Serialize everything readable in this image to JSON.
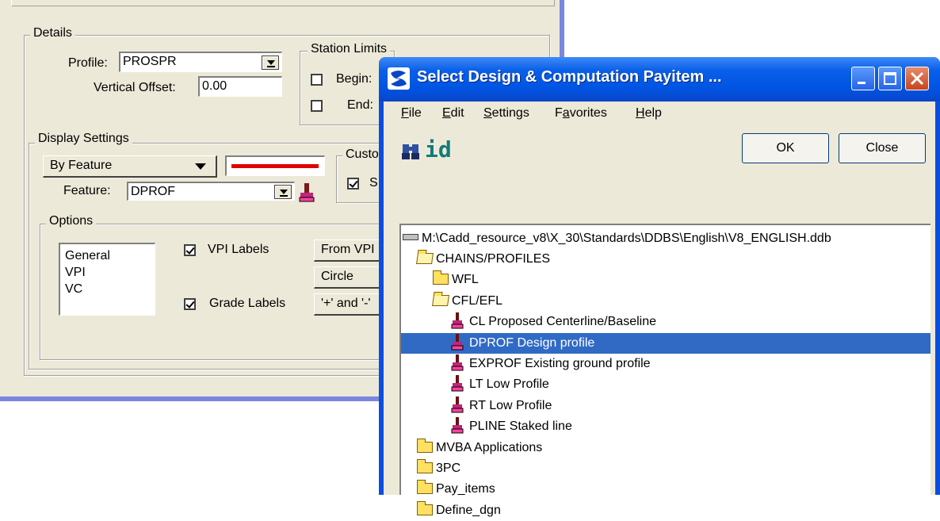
{
  "back_dialog": {
    "details_label": "Details",
    "profile_label": "Profile:",
    "profile_value": "PROSPR",
    "vertical_offset_label": "Vertical Offset:",
    "vertical_offset_value": "0.00",
    "station_limits_label": "Station Limits",
    "begin_label": "Begin:",
    "end_label": "End:",
    "display_settings_label": "Display Settings",
    "by_feature_value": "By Feature",
    "line_color": "#e00000",
    "custom_label": "Custo",
    "custom_check_label": "S",
    "feature_label": "Feature:",
    "feature_value": "DPROF",
    "options_label": "Options",
    "options_list": [
      "General",
      "VPI",
      "VC"
    ],
    "vpi_labels_label": "VPI Labels",
    "grade_labels_label": "Grade Labels",
    "from_vpi_value": "From VPI",
    "circle_value": "Circle",
    "plus_and_minus_value": "'+' and '-'"
  },
  "window": {
    "title": "Select Design & Computation Payitem ...",
    "menus": [
      {
        "label": "File",
        "accel": "F"
      },
      {
        "label": "Edit",
        "accel": "E"
      },
      {
        "label": "Settings",
        "accel": "S"
      },
      {
        "label": "Favorites",
        "accel": "a"
      },
      {
        "label": "Help",
        "accel": "H"
      }
    ],
    "ok_label": "OK",
    "close_label": "Close",
    "id_icon_text": "id",
    "tree": {
      "root": "M:\\Cadd_resource_v8\\X_30\\Standards\\DDBS\\English\\V8_ENGLISH.ddb",
      "items": [
        {
          "label": "CHAINS/PROFILES",
          "kind": "folder-open",
          "level": 1
        },
        {
          "label": "WFL",
          "kind": "folder",
          "level": 2
        },
        {
          "label": "CFL/EFL",
          "kind": "folder-open",
          "level": 2
        },
        {
          "label": "CL Proposed Centerline/Baseline",
          "kind": "item",
          "level": 3
        },
        {
          "label": "DPROF Design profile",
          "kind": "item",
          "level": 3,
          "selected": true
        },
        {
          "label": "EXPROF Existing ground profile",
          "kind": "item",
          "level": 3
        },
        {
          "label": "LT Low Profile",
          "kind": "item",
          "level": 3
        },
        {
          "label": "RT Low Profile",
          "kind": "item",
          "level": 3
        },
        {
          "label": "PLINE Staked line",
          "kind": "item",
          "level": 3
        },
        {
          "label": "MVBA Applications",
          "kind": "folder",
          "level": 1
        },
        {
          "label": "3PC",
          "kind": "folder",
          "level": 1
        },
        {
          "label": "Pay_items",
          "kind": "folder",
          "level": 1
        },
        {
          "label": "Define_dgn",
          "kind": "folder",
          "level": 1
        }
      ]
    }
  }
}
